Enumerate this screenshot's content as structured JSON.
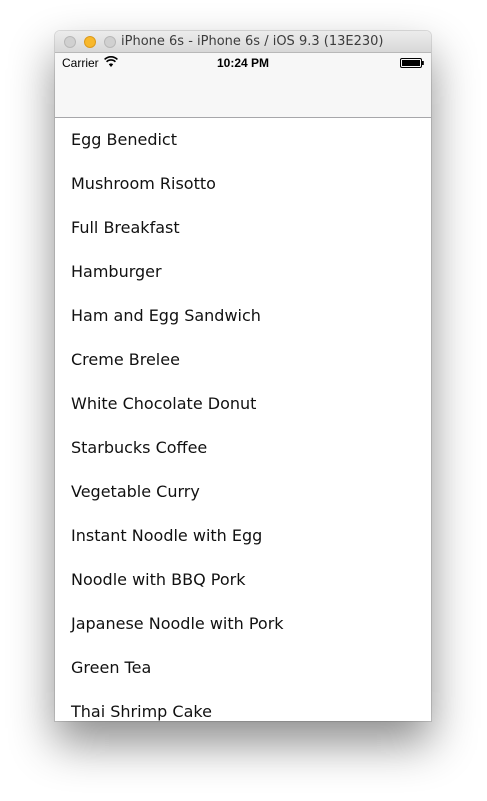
{
  "window": {
    "title": "iPhone 6s - iPhone 6s / iOS 9.3 (13E230)"
  },
  "status_bar": {
    "carrier": "Carrier",
    "time": "10:24 PM",
    "icons": [
      "wifi-icon",
      "battery-icon"
    ]
  },
  "list": {
    "items": [
      "Egg Benedict",
      "Mushroom Risotto",
      "Full Breakfast",
      "Hamburger",
      "Ham and Egg Sandwich",
      "Creme Brelee",
      "White Chocolate Donut",
      "Starbucks Coffee",
      "Vegetable Curry",
      "Instant Noodle with Egg",
      "Noodle with BBQ Pork",
      "Japanese Noodle with Pork",
      "Green Tea",
      "Thai Shrimp Cake"
    ]
  },
  "colors": {
    "traffic_light_minimize": "#f8b82c",
    "navbar_background": "#f7f7f7",
    "separator": "#a7a7aa"
  }
}
